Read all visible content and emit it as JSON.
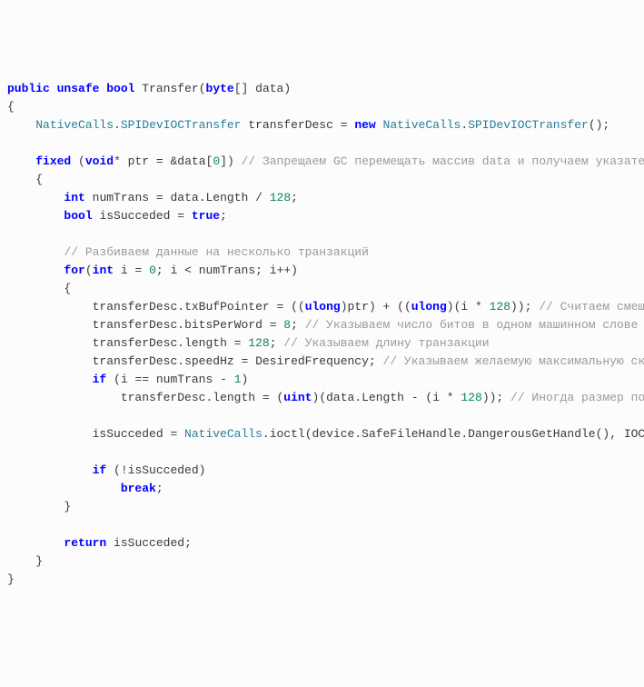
{
  "code": {
    "lines": [
      {
        "indent": 0,
        "tokens": [
          {
            "t": "public",
            "c": "kw"
          },
          {
            "t": " ",
            "c": ""
          },
          {
            "t": "unsafe",
            "c": "kw"
          },
          {
            "t": " ",
            "c": ""
          },
          {
            "t": "bool",
            "c": "kw"
          },
          {
            "t": " ",
            "c": ""
          },
          {
            "t": "Transfer",
            "c": "method"
          },
          {
            "t": "(",
            "c": "op"
          },
          {
            "t": "byte",
            "c": "kw"
          },
          {
            "t": "[] ",
            "c": "op"
          },
          {
            "t": "data",
            "c": "ident"
          },
          {
            "t": ")",
            "c": "op"
          }
        ]
      },
      {
        "indent": 0,
        "tokens": [
          {
            "t": "{",
            "c": "op"
          }
        ]
      },
      {
        "indent": 1,
        "tokens": [
          {
            "t": "NativeCalls",
            "c": "type"
          },
          {
            "t": ".",
            "c": "op"
          },
          {
            "t": "SPIDevIOCTransfer",
            "c": "type"
          },
          {
            "t": " ",
            "c": ""
          },
          {
            "t": "transferDesc",
            "c": "ident"
          },
          {
            "t": " = ",
            "c": "op"
          },
          {
            "t": "new",
            "c": "kw"
          },
          {
            "t": " ",
            "c": ""
          },
          {
            "t": "NativeCalls",
            "c": "type"
          },
          {
            "t": ".",
            "c": "op"
          },
          {
            "t": "SPIDevIOCTransfer",
            "c": "type"
          },
          {
            "t": "();",
            "c": "op"
          }
        ]
      },
      {
        "blank": true
      },
      {
        "indent": 1,
        "tokens": [
          {
            "t": "fixed",
            "c": "kw"
          },
          {
            "t": " (",
            "c": "op"
          },
          {
            "t": "void",
            "c": "kw"
          },
          {
            "t": "* ",
            "c": "op"
          },
          {
            "t": "ptr",
            "c": "ident"
          },
          {
            "t": " = &",
            "c": "op"
          },
          {
            "t": "data",
            "c": "ident"
          },
          {
            "t": "[",
            "c": "op"
          },
          {
            "t": "0",
            "c": "num"
          },
          {
            "t": "]) ",
            "c": "op"
          },
          {
            "t": "// Запрещаем GC перемещать массив data и получаем указател",
            "c": "comm"
          }
        ]
      },
      {
        "indent": 1,
        "tokens": [
          {
            "t": "{",
            "c": "op"
          }
        ]
      },
      {
        "indent": 2,
        "tokens": [
          {
            "t": "int",
            "c": "kw"
          },
          {
            "t": " ",
            "c": ""
          },
          {
            "t": "numTrans",
            "c": "ident"
          },
          {
            "t": " = ",
            "c": "op"
          },
          {
            "t": "data",
            "c": "ident"
          },
          {
            "t": ".",
            "c": "op"
          },
          {
            "t": "Length",
            "c": "prop"
          },
          {
            "t": " / ",
            "c": "op"
          },
          {
            "t": "128",
            "c": "num"
          },
          {
            "t": ";",
            "c": "op"
          }
        ]
      },
      {
        "indent": 2,
        "tokens": [
          {
            "t": "bool",
            "c": "kw"
          },
          {
            "t": " ",
            "c": ""
          },
          {
            "t": "isSucceded",
            "c": "ident"
          },
          {
            "t": " = ",
            "c": "op"
          },
          {
            "t": "true",
            "c": "kw"
          },
          {
            "t": ";",
            "c": "op"
          }
        ]
      },
      {
        "blank": true
      },
      {
        "indent": 2,
        "tokens": [
          {
            "t": "// Разбиваем данные на несколько транзакций",
            "c": "comm"
          }
        ]
      },
      {
        "indent": 2,
        "tokens": [
          {
            "t": "for",
            "c": "kw"
          },
          {
            "t": "(",
            "c": "op"
          },
          {
            "t": "int",
            "c": "kw"
          },
          {
            "t": " ",
            "c": ""
          },
          {
            "t": "i",
            "c": "ident"
          },
          {
            "t": " = ",
            "c": "op"
          },
          {
            "t": "0",
            "c": "num"
          },
          {
            "t": "; ",
            "c": "op"
          },
          {
            "t": "i",
            "c": "ident"
          },
          {
            "t": " < ",
            "c": "op"
          },
          {
            "t": "numTrans",
            "c": "ident"
          },
          {
            "t": "; ",
            "c": "op"
          },
          {
            "t": "i",
            "c": "ident"
          },
          {
            "t": "++)",
            "c": "op"
          }
        ]
      },
      {
        "indent": 2,
        "tokens": [
          {
            "t": "{",
            "c": "op"
          }
        ]
      },
      {
        "indent": 3,
        "tokens": [
          {
            "t": "transferDesc",
            "c": "ident"
          },
          {
            "t": ".",
            "c": "op"
          },
          {
            "t": "txBufPointer",
            "c": "prop"
          },
          {
            "t": " = ((",
            "c": "op"
          },
          {
            "t": "ulong",
            "c": "kw"
          },
          {
            "t": ")",
            "c": "op"
          },
          {
            "t": "ptr",
            "c": "ident"
          },
          {
            "t": ") + ((",
            "c": "op"
          },
          {
            "t": "ulong",
            "c": "kw"
          },
          {
            "t": ")(",
            "c": "op"
          },
          {
            "t": "i",
            "c": "ident"
          },
          {
            "t": " * ",
            "c": "op"
          },
          {
            "t": "128",
            "c": "num"
          },
          {
            "t": ")); ",
            "c": "op"
          },
          {
            "t": "// Считаем смещ",
            "c": "comm"
          }
        ]
      },
      {
        "indent": 3,
        "tokens": [
          {
            "t": "transferDesc",
            "c": "ident"
          },
          {
            "t": ".",
            "c": "op"
          },
          {
            "t": "bitsPerWord",
            "c": "prop"
          },
          {
            "t": " = ",
            "c": "op"
          },
          {
            "t": "8",
            "c": "num"
          },
          {
            "t": "; ",
            "c": "op"
          },
          {
            "t": "// Указываем число битов в одном машинном слове ",
            "c": "comm"
          }
        ]
      },
      {
        "indent": 3,
        "tokens": [
          {
            "t": "transferDesc",
            "c": "ident"
          },
          {
            "t": ".",
            "c": "op"
          },
          {
            "t": "length",
            "c": "prop"
          },
          {
            "t": " = ",
            "c": "op"
          },
          {
            "t": "128",
            "c": "num"
          },
          {
            "t": "; ",
            "c": "op"
          },
          {
            "t": "// Указываем длину транзакции",
            "c": "comm"
          }
        ]
      },
      {
        "indent": 3,
        "tokens": [
          {
            "t": "transferDesc",
            "c": "ident"
          },
          {
            "t": ".",
            "c": "op"
          },
          {
            "t": "speedHz",
            "c": "prop"
          },
          {
            "t": " = ",
            "c": "op"
          },
          {
            "t": "DesiredFrequency",
            "c": "ident"
          },
          {
            "t": "; ",
            "c": "op"
          },
          {
            "t": "// Указываем желаемую максимальную ско",
            "c": "comm"
          }
        ]
      },
      {
        "indent": 3,
        "tokens": [
          {
            "t": "if",
            "c": "kw"
          },
          {
            "t": " (",
            "c": "op"
          },
          {
            "t": "i",
            "c": "ident"
          },
          {
            "t": " == ",
            "c": "op"
          },
          {
            "t": "numTrans",
            "c": "ident"
          },
          {
            "t": " - ",
            "c": "op"
          },
          {
            "t": "1",
            "c": "num"
          },
          {
            "t": ")",
            "c": "op"
          }
        ]
      },
      {
        "indent": 4,
        "tokens": [
          {
            "t": "transferDesc",
            "c": "ident"
          },
          {
            "t": ".",
            "c": "op"
          },
          {
            "t": "length",
            "c": "prop"
          },
          {
            "t": " = (",
            "c": "op"
          },
          {
            "t": "uint",
            "c": "kw"
          },
          {
            "t": ")(",
            "c": "op"
          },
          {
            "t": "data",
            "c": "ident"
          },
          {
            "t": ".",
            "c": "op"
          },
          {
            "t": "Length",
            "c": "prop"
          },
          {
            "t": " - (",
            "c": "op"
          },
          {
            "t": "i",
            "c": "ident"
          },
          {
            "t": " * ",
            "c": "op"
          },
          {
            "t": "128",
            "c": "num"
          },
          {
            "t": ")); ",
            "c": "op"
          },
          {
            "t": "// Иногда размер по",
            "c": "comm"
          }
        ]
      },
      {
        "blank": true
      },
      {
        "indent": 3,
        "tokens": [
          {
            "t": "isSucceded",
            "c": "ident"
          },
          {
            "t": " = ",
            "c": "op"
          },
          {
            "t": "NativeCalls",
            "c": "type"
          },
          {
            "t": ".",
            "c": "op"
          },
          {
            "t": "ioctl",
            "c": "method"
          },
          {
            "t": "(",
            "c": "op"
          },
          {
            "t": "device",
            "c": "ident"
          },
          {
            "t": ".",
            "c": "op"
          },
          {
            "t": "SafeFileHandle",
            "c": "prop"
          },
          {
            "t": ".",
            "c": "op"
          },
          {
            "t": "DangerousGetHandle",
            "c": "method"
          },
          {
            "t": "(), ",
            "c": "op"
          },
          {
            "t": "IOC",
            "c": "ident"
          }
        ]
      },
      {
        "blank": true
      },
      {
        "indent": 3,
        "tokens": [
          {
            "t": "if",
            "c": "kw"
          },
          {
            "t": " (!",
            "c": "op"
          },
          {
            "t": "isSucceded",
            "c": "ident"
          },
          {
            "t": ")",
            "c": "op"
          }
        ]
      },
      {
        "indent": 4,
        "tokens": [
          {
            "t": "break",
            "c": "kw"
          },
          {
            "t": ";",
            "c": "op"
          }
        ]
      },
      {
        "indent": 2,
        "tokens": [
          {
            "t": "}",
            "c": "op"
          }
        ]
      },
      {
        "blank": true
      },
      {
        "indent": 2,
        "tokens": [
          {
            "t": "return",
            "c": "kw"
          },
          {
            "t": " ",
            "c": ""
          },
          {
            "t": "isSucceded",
            "c": "ident"
          },
          {
            "t": ";",
            "c": "op"
          }
        ]
      },
      {
        "indent": 1,
        "tokens": [
          {
            "t": "}",
            "c": "op"
          }
        ]
      },
      {
        "indent": 0,
        "tokens": [
          {
            "t": "}",
            "c": "op"
          }
        ]
      }
    ],
    "indentUnit": "    "
  }
}
